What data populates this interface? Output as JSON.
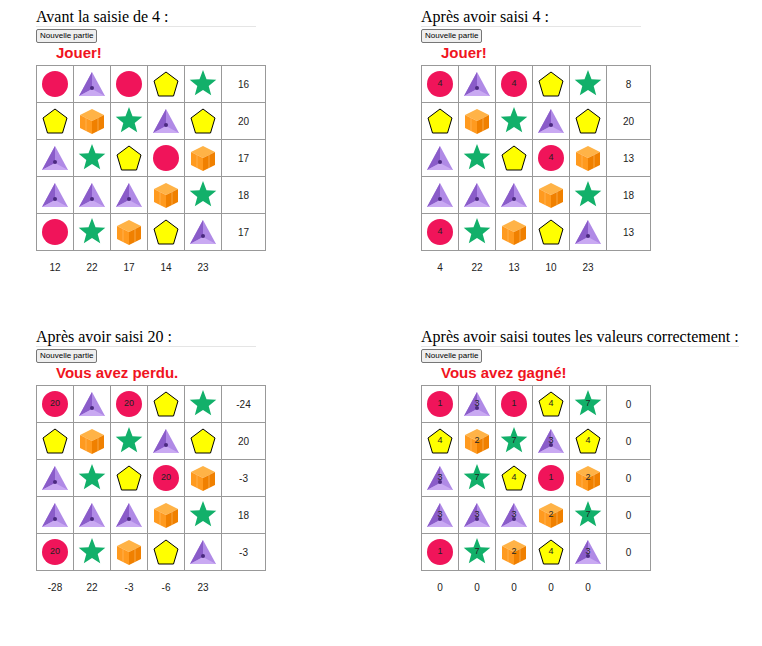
{
  "panels": [
    {
      "title": "Avant la saisie de 4 :",
      "button": "Nouvelle partie",
      "status": "Jouer!",
      "cells": [
        [
          {
            "kind": "circle"
          },
          {
            "kind": "pyramid"
          },
          {
            "kind": "circle"
          },
          {
            "kind": "pentagon"
          },
          {
            "kind": "star"
          }
        ],
        [
          {
            "kind": "pentagon"
          },
          {
            "kind": "cube"
          },
          {
            "kind": "star"
          },
          {
            "kind": "pyramid"
          },
          {
            "kind": "pentagon"
          }
        ],
        [
          {
            "kind": "pyramid"
          },
          {
            "kind": "star"
          },
          {
            "kind": "pentagon"
          },
          {
            "kind": "circle"
          },
          {
            "kind": "cube"
          }
        ],
        [
          {
            "kind": "pyramid"
          },
          {
            "kind": "pyramid"
          },
          {
            "kind": "pyramid"
          },
          {
            "kind": "cube"
          },
          {
            "kind": "star"
          }
        ],
        [
          {
            "kind": "circle"
          },
          {
            "kind": "star"
          },
          {
            "kind": "cube"
          },
          {
            "kind": "pentagon"
          },
          {
            "kind": "pyramid"
          }
        ]
      ],
      "rowSums": [
        "16",
        "20",
        "17",
        "18",
        "17"
      ],
      "colSums": [
        "12",
        "22",
        "17",
        "14",
        "23"
      ]
    },
    {
      "title": "Après avoir saisi 4 :",
      "button": "Nouvelle partie",
      "status": "Jouer!",
      "cells": [
        [
          {
            "kind": "circle",
            "label": "4"
          },
          {
            "kind": "pyramid"
          },
          {
            "kind": "circle",
            "label": "4"
          },
          {
            "kind": "pentagon"
          },
          {
            "kind": "star"
          }
        ],
        [
          {
            "kind": "pentagon"
          },
          {
            "kind": "cube"
          },
          {
            "kind": "star"
          },
          {
            "kind": "pyramid"
          },
          {
            "kind": "pentagon"
          }
        ],
        [
          {
            "kind": "pyramid"
          },
          {
            "kind": "star"
          },
          {
            "kind": "pentagon"
          },
          {
            "kind": "circle",
            "label": "4"
          },
          {
            "kind": "cube"
          }
        ],
        [
          {
            "kind": "pyramid"
          },
          {
            "kind": "pyramid"
          },
          {
            "kind": "pyramid"
          },
          {
            "kind": "cube"
          },
          {
            "kind": "star"
          }
        ],
        [
          {
            "kind": "circle",
            "label": "4"
          },
          {
            "kind": "star"
          },
          {
            "kind": "cube"
          },
          {
            "kind": "pentagon"
          },
          {
            "kind": "pyramid"
          }
        ]
      ],
      "rowSums": [
        "8",
        "20",
        "13",
        "18",
        "13"
      ],
      "colSums": [
        "4",
        "22",
        "13",
        "10",
        "23"
      ]
    },
    {
      "title": "Après avoir saisi 20 :",
      "button": "Nouvelle partie",
      "status": "Vous avez perdu.",
      "cells": [
        [
          {
            "kind": "circle",
            "label": "20"
          },
          {
            "kind": "pyramid"
          },
          {
            "kind": "circle",
            "label": "20"
          },
          {
            "kind": "pentagon"
          },
          {
            "kind": "star"
          }
        ],
        [
          {
            "kind": "pentagon"
          },
          {
            "kind": "cube"
          },
          {
            "kind": "star"
          },
          {
            "kind": "pyramid"
          },
          {
            "kind": "pentagon"
          }
        ],
        [
          {
            "kind": "pyramid"
          },
          {
            "kind": "star"
          },
          {
            "kind": "pentagon"
          },
          {
            "kind": "circle",
            "label": "20"
          },
          {
            "kind": "cube"
          }
        ],
        [
          {
            "kind": "pyramid"
          },
          {
            "kind": "pyramid"
          },
          {
            "kind": "pyramid"
          },
          {
            "kind": "cube"
          },
          {
            "kind": "star"
          }
        ],
        [
          {
            "kind": "circle",
            "label": "20"
          },
          {
            "kind": "star"
          },
          {
            "kind": "cube"
          },
          {
            "kind": "pentagon"
          },
          {
            "kind": "pyramid"
          }
        ]
      ],
      "rowSums": [
        "-24",
        "20",
        "-3",
        "18",
        "-3"
      ],
      "colSums": [
        "-28",
        "22",
        "-3",
        "-6",
        "23"
      ]
    },
    {
      "title": "Après avoir saisi toutes les valeurs correctement :",
      "button": "Nouvelle partie",
      "status": "Vous avez gagné!",
      "cells": [
        [
          {
            "kind": "circle",
            "label": "1"
          },
          {
            "kind": "pyramid",
            "label": "3"
          },
          {
            "kind": "circle",
            "label": "1"
          },
          {
            "kind": "pentagon",
            "label": "4"
          },
          {
            "kind": "star",
            "label": "7"
          }
        ],
        [
          {
            "kind": "pentagon",
            "label": "4"
          },
          {
            "kind": "cube",
            "label": "2"
          },
          {
            "kind": "star",
            "label": "7"
          },
          {
            "kind": "pyramid",
            "label": "3"
          },
          {
            "kind": "pentagon",
            "label": "4"
          }
        ],
        [
          {
            "kind": "pyramid",
            "label": "3"
          },
          {
            "kind": "star",
            "label": "7"
          },
          {
            "kind": "pentagon",
            "label": "4"
          },
          {
            "kind": "circle",
            "label": "1"
          },
          {
            "kind": "cube",
            "label": "2"
          }
        ],
        [
          {
            "kind": "pyramid",
            "label": "3"
          },
          {
            "kind": "pyramid",
            "label": "3"
          },
          {
            "kind": "pyramid",
            "label": "3"
          },
          {
            "kind": "cube",
            "label": "2"
          },
          {
            "kind": "star",
            "label": "7"
          }
        ],
        [
          {
            "kind": "circle",
            "label": "1"
          },
          {
            "kind": "star",
            "label": "7"
          },
          {
            "kind": "cube",
            "label": "2"
          },
          {
            "kind": "pentagon",
            "label": "4"
          },
          {
            "kind": "pyramid",
            "label": "3"
          }
        ]
      ],
      "rowSums": [
        "0",
        "0",
        "0",
        "0",
        "0"
      ],
      "colSums": [
        "0",
        "0",
        "0",
        "0",
        "0"
      ]
    }
  ]
}
